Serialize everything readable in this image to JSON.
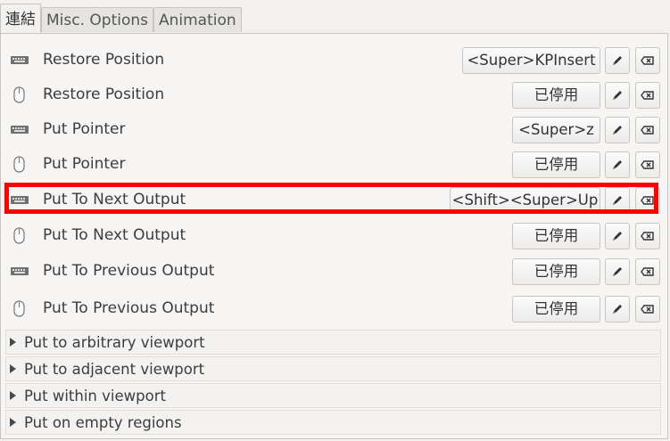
{
  "tabs": [
    "連結",
    "Misc. Options",
    "Animation"
  ],
  "bindings": [
    {
      "icon": "keyboard-icon",
      "label": "Restore Position",
      "accel": "<Super>KPInsert"
    },
    {
      "icon": "mouse-icon",
      "label": "Restore Position",
      "accel": "已停用"
    },
    {
      "icon": "keyboard-icon",
      "label": "Put Pointer",
      "accel": "<Super>z"
    },
    {
      "icon": "mouse-icon",
      "label": "Put Pointer",
      "accel": "已停用"
    },
    {
      "icon": "keyboard-icon",
      "label": "Put To Next Output",
      "accel": "<Shift><Super>Up"
    },
    {
      "icon": "mouse-icon",
      "label": "Put To Next Output",
      "accel": "已停用"
    },
    {
      "icon": "keyboard-icon",
      "label": "Put To Previous Output",
      "accel": "已停用"
    },
    {
      "icon": "mouse-icon",
      "label": "Put To Previous Output",
      "accel": "已停用"
    }
  ],
  "sections": [
    "Put to arbitrary viewport",
    "Put to adjacent viewport",
    "Put within viewport",
    "Put on empty regions"
  ],
  "highlighted_row": "Put To Next Output"
}
